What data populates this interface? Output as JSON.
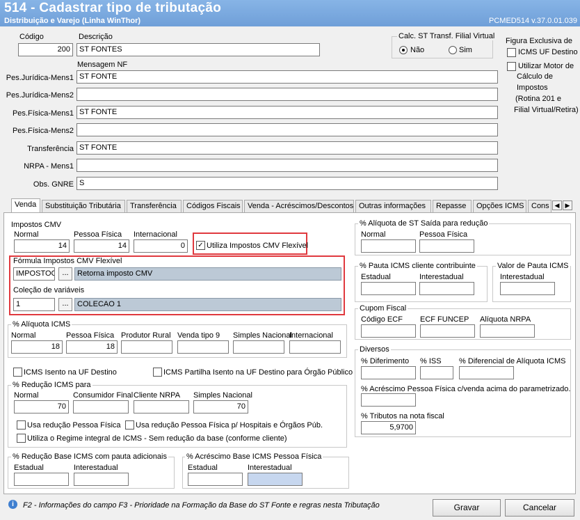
{
  "window": {
    "title": "514 - Cadastrar tipo de tributação",
    "subtitle": "Distribuição e Varejo (Linha WinThor)",
    "version": "PCMED514  v.37.0.01.039"
  },
  "header": {
    "codigo_label": "Código",
    "codigo_value": "200",
    "descricao_label": "Descrição",
    "descricao_value": "ST FONTES",
    "calc_st_label": "Calc. ST Transf. Filial Virtual",
    "calc_st_nao": "Não",
    "calc_st_sim": "Sim",
    "figura_label": "Figura Exclusiva de",
    "icms_uf_destino": "ICMS UF Destino",
    "motor_lines": [
      "Utilizar Motor de",
      "Cálculo de",
      "Impostos",
      "(Rotina 201 e",
      "Filial Virtual/Retira)"
    ],
    "mensagem_nf_label": "Mensagem NF",
    "rows": [
      {
        "label": "Pes.Jurídica-Mens1",
        "value": "ST FONTE"
      },
      {
        "label": "Pes.Jurídica-Mens2",
        "value": ""
      },
      {
        "label": "Pes.Física-Mens1",
        "value": "ST FONTE"
      },
      {
        "label": "Pes.Física-Mens2",
        "value": ""
      },
      {
        "label": "Transferência",
        "value": "ST FONTE"
      },
      {
        "label": "NRPA - Mens1",
        "value": ""
      },
      {
        "label": "Obs. GNRE",
        "value": "S"
      }
    ]
  },
  "tabs": [
    "Venda",
    "Substituição Tributária",
    "Transferência",
    "Códigos Fiscais",
    "Venda - Acréscimos/Descontos",
    "Outras informações",
    "Repasse",
    "Opções ICMS",
    "Cons"
  ],
  "venda": {
    "impostos_cmv": {
      "title": "Impostos CMV",
      "normal_label": "Normal",
      "normal_value": "14",
      "pf_label": "Pessoa Física",
      "pf_value": "14",
      "intl_label": "Internacional",
      "intl_value": "0",
      "flex_label": "Utiliza Impostos CMV Flexível",
      "formula_label": "Fórmula Impostos CMV Flexível",
      "formula_code": "IMPOSTOCM",
      "formula_desc": "Retorna imposto CMV",
      "colecao_label": "Coleção de variáveis",
      "colecao_code": "1",
      "colecao_desc": "COLECAO 1",
      "ellipsis": "..."
    },
    "aliquota_icms": {
      "title": "% Alíquota ICMS",
      "labels": [
        "Normal",
        "Pessoa Física",
        "Produtor Rural",
        "Venda tipo 9",
        "Simples Nacional",
        "Internacional"
      ],
      "values": [
        "18",
        "18",
        "",
        "",
        "",
        ""
      ]
    },
    "icms_isento": "ICMS Isento na UF Destino",
    "icms_partilha": "ICMS Partilha Isento na UF Destino para Órgão Público",
    "reducao_icms": {
      "title": "% Redução ICMS para",
      "labels": [
        "Normal",
        "Consumidor Final",
        "Cliente NRPA",
        "Simples Nacional"
      ],
      "values": [
        "70",
        "",
        "",
        "70"
      ]
    },
    "usa_reducao_pf": "Usa redução Pessoa Física",
    "usa_reducao_pf_hosp": "Usa redução Pessoa Física p/ Hospitais e Órgãos Púb.",
    "regime_integral": "Utiliza o Regime integral  de ICMS - Sem redução da base (conforme cliente)",
    "reducao_base_pauta": {
      "title": "% Redução Base ICMS com pauta adicionais",
      "estadual": "Estadual",
      "interestadual": "Interestadual"
    },
    "acrescimo_base_pf": {
      "title": "% Acréscimo Base ICMS Pessoa Física",
      "estadual": "Estadual",
      "interestadual": "Interestadual"
    },
    "aliquota_st_saida": {
      "title": "% Alíquota de ST Saída para redução",
      "normal": "Normal",
      "pf": "Pessoa Física"
    },
    "pauta_icms": {
      "title": "% Pauta ICMS cliente contribuinte",
      "estadual": "Estadual",
      "interestadual": "Interestadual"
    },
    "valor_pauta": {
      "title": "Valor de Pauta ICMS",
      "interestadual": "Interestadual"
    },
    "cupom_fiscal": {
      "title": "Cupom Fiscal",
      "codigo_ecf": "Código ECF",
      "ecf_funcep": "ECF FUNCEP",
      "aliquota_nrpa": "Alíquota NRPA"
    },
    "diversos": {
      "title": "Diversos",
      "diferimento": "% Diferimento",
      "iss": "% ISS",
      "diferencial": "% Diferencial de Alíquota ICMS",
      "acrescimo_pf": "% Acréscimo Pessoa Física c/venda acima do parametrizado.",
      "tributos": "% Tributos na nota fiscal",
      "tributos_value": "5,9700"
    }
  },
  "footer": {
    "help_text": "F2 - Informações do campo   F3 - Prioridade na Formação da Base do ST Fonte e regras nesta Tributação",
    "gravar": "Gravar",
    "cancelar": "Cancelar"
  }
}
